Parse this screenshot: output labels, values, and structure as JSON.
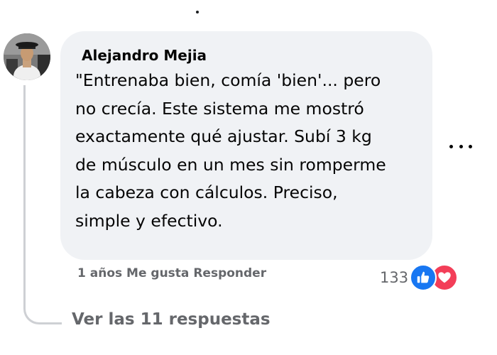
{
  "comment": {
    "author": "Alejandro Mejia",
    "text": "\"Entrenaba bien, comía 'bien'... pero\nno crecía. Este sistema me mostró\nexactamente qué ajustar. Subí 3 kg\nde músculo en un mes sin romperme\nla cabeza con cálculos. Preciso,\nsimple y efectivo.",
    "time": "1 años",
    "like_label": "Me gusta",
    "reply_label": "Responder",
    "reaction_count": "133",
    "reactions": [
      "like-icon",
      "love-icon"
    ],
    "more_options_icon": "more-horizontal-icon"
  },
  "replies": {
    "view_label": "Ver las 11 respuestas"
  },
  "colors": {
    "bubble_bg": "#f0f2f5",
    "secondary_text": "#65676b",
    "like_blue": "#1877f2",
    "love_red": "#f33e58"
  }
}
